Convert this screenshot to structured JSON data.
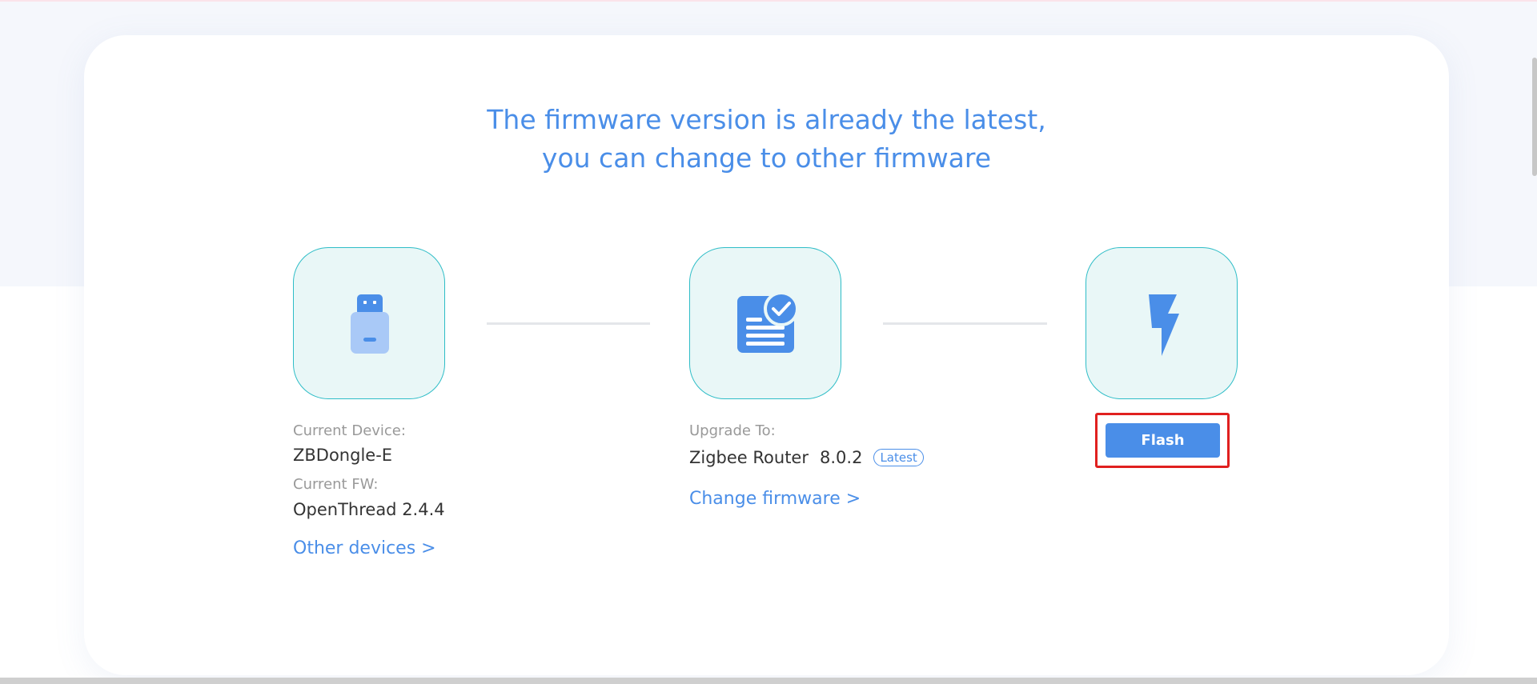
{
  "headline": {
    "line1": "The firmware version is already the latest,",
    "line2": "you can change to other firmware"
  },
  "device": {
    "label": "Current Device:",
    "value": "ZBDongle-E",
    "fw_label": "Current FW:",
    "fw_value": "OpenThread 2.4.4",
    "link": "Other devices >",
    "icon": "usb-dongle-icon"
  },
  "firmware": {
    "label": "Upgrade To:",
    "name": "Zigbee Router",
    "version": "8.0.2",
    "badge": "Latest",
    "link": "Change firmware >",
    "icon": "firmware-document-check-icon"
  },
  "flash": {
    "button_label": "Flash",
    "icon": "lightning-bolt-icon"
  },
  "colors": {
    "accent": "#4a8ee8",
    "step_border": "#2ebdc7",
    "step_fill": "#e9f7f7",
    "highlight": "#e0201f"
  }
}
